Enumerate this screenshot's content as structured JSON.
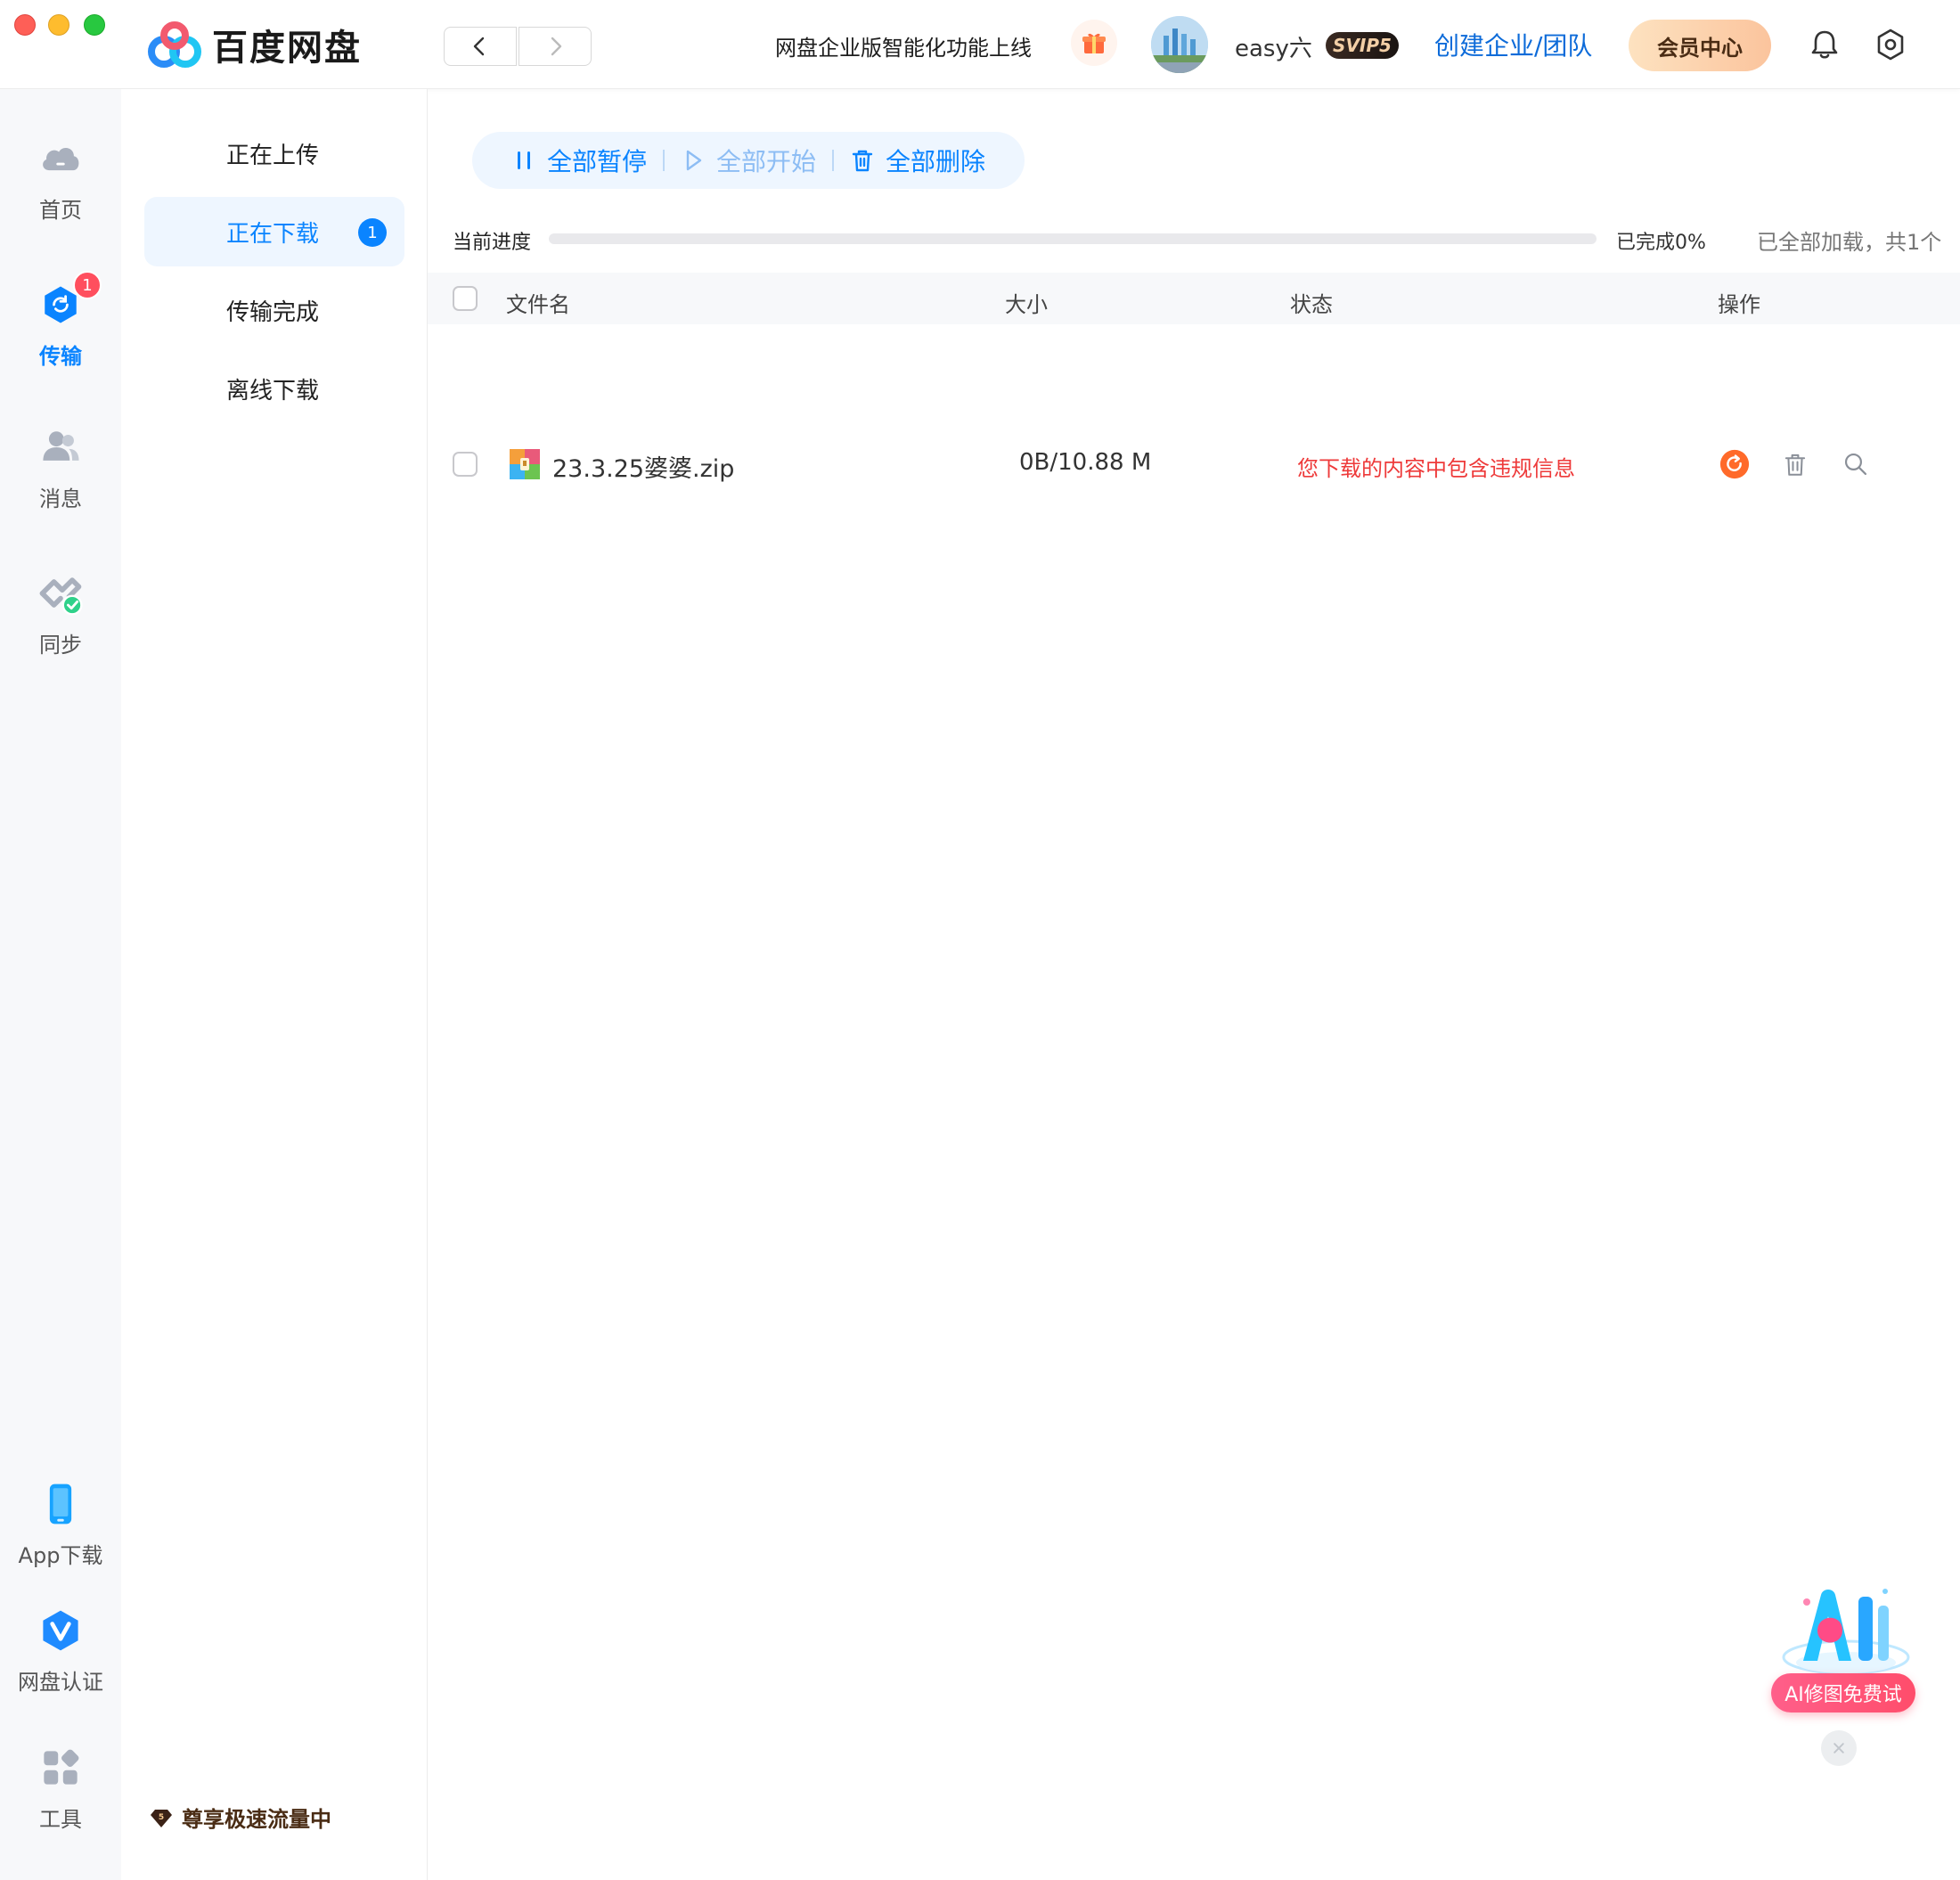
{
  "app": {
    "name": "百度网盘",
    "promo_text": "网盘企业版智能化功能上线",
    "username": "easy六",
    "vip_badge": "SVIP5",
    "create_team": "创建企业/团队",
    "member_center": "会员中心"
  },
  "rail": {
    "home": "首页",
    "transfer": "传输",
    "transfer_badge": "1",
    "messages": "消息",
    "sync": "同步",
    "app_download": "App下载",
    "verify": "网盘认证",
    "tools": "工具"
  },
  "subnav": {
    "uploading": "正在上传",
    "downloading": "正在下载",
    "downloading_badge": "1",
    "completed": "传输完成",
    "offline": "离线下载",
    "speed_note": "尊享极速流量中"
  },
  "toolbar": {
    "pause_all": "全部暂停",
    "start_all": "全部开始",
    "delete_all": "全部删除"
  },
  "progress": {
    "label": "当前进度",
    "percent": "已完成0%",
    "fraction": 0,
    "loaded_info": "已全部加载，共1个"
  },
  "table": {
    "columns": [
      "文件名",
      "大小",
      "状态",
      "操作"
    ],
    "rows": [
      {
        "name": "23.3.25婆婆.zip",
        "size": "0B/10.88 M",
        "status": "您下载的内容中包含违规信息"
      }
    ]
  },
  "ai_widget": {
    "label": "AI修图免费试"
  },
  "colors": {
    "accent": "#0a84ff",
    "error": "#ee3a3a",
    "retry": "#ff6a2a"
  }
}
